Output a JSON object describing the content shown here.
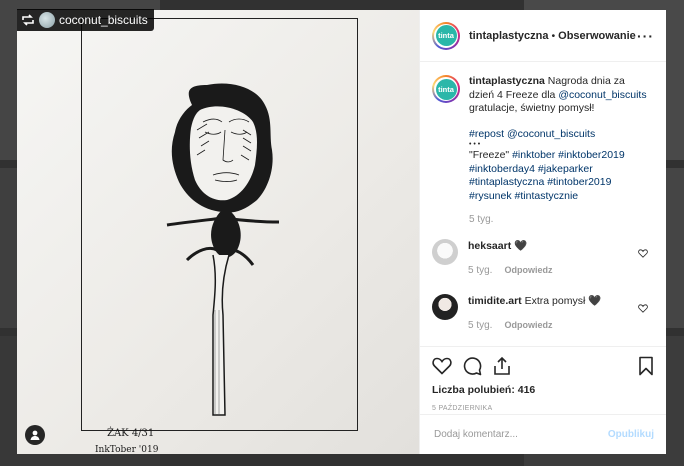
{
  "repost_badge": {
    "username": "coconut_biscuits",
    "icon": "repost-icon"
  },
  "image": {
    "alt_signature": "ŻAK 4/31",
    "alt_caption": "InkTober '019"
  },
  "header": {
    "avatar_text": "tinta",
    "username": "tintaplastyczna",
    "separator": "•",
    "follow_label": "Obserwowanie",
    "more_label": "···"
  },
  "caption": {
    "username": "tintaplastyczna",
    "line1": " Nagroda dnia za dzień 4 Freeze dla ",
    "mention": "@coconut_biscuits",
    "line2": " gratulacje, świetny pomysł!",
    "repost_tags": "#repost @coconut_biscuits",
    "dots": "• • •",
    "quote": "\"Freeze\" ",
    "hashtags": "#inktober #inktober2019 #inktoberday4 #jakeparker #tintaplastyczna #tintober2019 #rysunek #tintastycznie",
    "time": "5 tyg."
  },
  "comments": [
    {
      "username": "heksaart",
      "text": " 🖤",
      "time": "5 tyg.",
      "reply_label": "Odpowiedz"
    },
    {
      "username": "timidite.art",
      "text": " Extra pomysł 🖤",
      "time": "5 tyg.",
      "reply_label": "Odpowiedz"
    }
  ],
  "actions": {
    "likes_label": "Liczba polubień: 416",
    "date": "5 PAŹDZIERNIKA"
  },
  "comment_input": {
    "placeholder": "Dodaj komentarz...",
    "publish_label": "Opublikuj"
  },
  "colors": {
    "brand_teal": "#2ab7a9",
    "link": "#003569",
    "publish_disabled": "#b3dbff"
  }
}
